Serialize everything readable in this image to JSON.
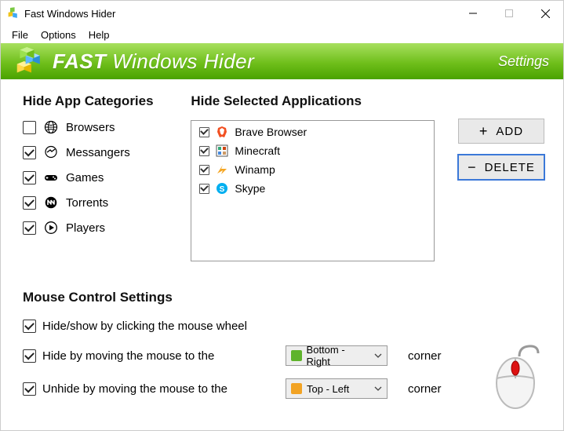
{
  "window": {
    "title": "Fast Windows Hider"
  },
  "menu": {
    "file": "File",
    "options": "Options",
    "help": "Help"
  },
  "banner": {
    "product_bold": "FAST",
    "product_rest": " Windows Hider",
    "page": "Settings"
  },
  "sections": {
    "categories": "Hide App Categories",
    "applications": "Hide Selected Applications",
    "mouse": "Mouse Control Settings"
  },
  "categories": [
    {
      "label": "Browsers",
      "checked": false,
      "icon": "globe-icon"
    },
    {
      "label": "Messangers",
      "checked": true,
      "icon": "messenger-icon"
    },
    {
      "label": "Games",
      "checked": true,
      "icon": "gamepad-icon"
    },
    {
      "label": "Torrents",
      "checked": true,
      "icon": "torrent-icon"
    },
    {
      "label": "Players",
      "checked": true,
      "icon": "play-circle-icon"
    }
  ],
  "applications": [
    {
      "label": "Brave Browser",
      "checked": true,
      "icon": "brave-icon"
    },
    {
      "label": "Minecraft",
      "checked": true,
      "icon": "minecraft-icon"
    },
    {
      "label": "Winamp",
      "checked": true,
      "icon": "winamp-icon"
    },
    {
      "label": "Skype",
      "checked": true,
      "icon": "skype-icon"
    }
  ],
  "buttons": {
    "add": "ADD",
    "delete": "DELETE"
  },
  "mouse": {
    "opt1": "Hide/show by clicking the mouse wheel",
    "opt2": "Hide by moving the mouse to the",
    "opt3": "Unhide by moving the mouse to the",
    "corner_word": "corner",
    "select_hide": "Bottom - Right",
    "select_unhide": "Top - Left"
  },
  "colors": {
    "select_hide_sq": "#5fb32b",
    "select_unhide_sq": "#f2a324"
  }
}
